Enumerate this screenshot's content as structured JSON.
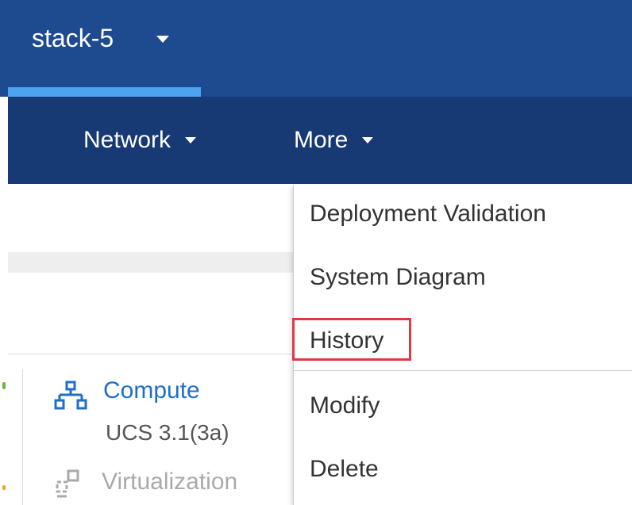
{
  "header": {
    "stack_name": "stack-5",
    "accent_color": "#1e4a8f",
    "active_underline_color": "#4da3f0"
  },
  "nav": {
    "items": [
      {
        "label": "Network"
      },
      {
        "label": "More"
      }
    ]
  },
  "content": {
    "compute": {
      "label": "Compute",
      "version": "UCS 3.1(3a)",
      "icon": "network-topology-icon"
    },
    "virtualization": {
      "label": "Virtualization",
      "icon": "virtualization-icon"
    }
  },
  "more_menu": {
    "items": [
      {
        "label": "Deployment Validation"
      },
      {
        "label": "System Diagram"
      },
      {
        "label": "History",
        "highlighted": true,
        "highlight_color": "#e0393e"
      },
      {
        "label": "Modify"
      },
      {
        "label": "Delete"
      }
    ]
  }
}
